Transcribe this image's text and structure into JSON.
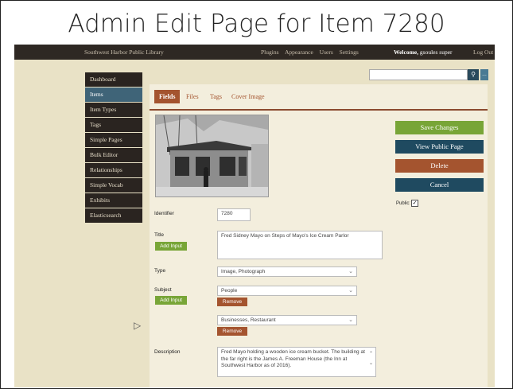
{
  "slide": {
    "title": "Admin Edit Page for Item 7280"
  },
  "topbar": {
    "site_name": "Southwest Harbor Public Library",
    "nav": [
      "Plugins",
      "Appearance",
      "Users",
      "Settings"
    ],
    "welcome_prefix": "Welcome,",
    "username": "gsoules super",
    "logout": "Log Out"
  },
  "search": {
    "placeholder": "",
    "button_icon": "search-icon"
  },
  "sidebar": {
    "items": [
      {
        "label": "Dashboard",
        "active": false
      },
      {
        "label": "Items",
        "active": true
      },
      {
        "label": "Item Types",
        "active": false
      },
      {
        "label": "Tags",
        "active": false
      },
      {
        "label": "Simple Pages",
        "active": false
      },
      {
        "label": "Bulk Editor",
        "active": false
      },
      {
        "label": "Relationships",
        "active": false
      },
      {
        "label": "Simple Vocab",
        "active": false
      },
      {
        "label": "Exhibits",
        "active": false
      },
      {
        "label": "Elasticsearch",
        "active": false
      }
    ]
  },
  "tabs": [
    "Fields",
    "Files",
    "Tags",
    "Cover Image"
  ],
  "form": {
    "identifier_label": "Identifier",
    "identifier_value": "7280",
    "title_label": "Title",
    "title_value": "Fred Sidney Mayo on Steps of Mayo's Ice Cream Parlor",
    "add_input": "Add Input",
    "type_label": "Type",
    "type_value": "Image, Photograph",
    "subject_label": "Subject",
    "subject_values": [
      "People",
      "Businesses, Restaurant"
    ],
    "remove": "Remove",
    "description_label": "Description",
    "description_value": "Fred Mayo holding a wooden ice cream bucket. The building at the far right is the James A. Freeman House (the Inn at Southwest Harbor as of 2016)."
  },
  "actions": {
    "save": "Save Changes",
    "view_public": "View Public Page",
    "delete": "Delete",
    "cancel": "Cancel",
    "public_label": "Public:",
    "public_checked": true
  },
  "colors": {
    "green": "#78a537",
    "navy": "#1f4a60",
    "rust": "#a4542f"
  }
}
